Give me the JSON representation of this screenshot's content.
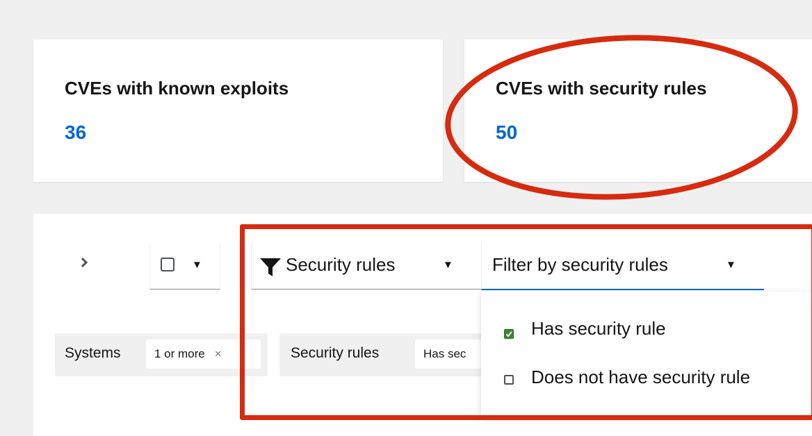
{
  "cards": [
    {
      "title": "CVEs with known exploits",
      "value": "36"
    },
    {
      "title": "CVEs with security rules",
      "value": "50"
    }
  ],
  "toolbar": {
    "expand_icon": "chevron-right-icon",
    "bulk_select_caret": "▼",
    "attribute_filter": {
      "label": "Security rules",
      "icon": "filter-icon",
      "caret": "▼"
    },
    "value_filter": {
      "placeholder": "Filter by security rules",
      "caret": "▼"
    }
  },
  "filter_chips": [
    {
      "category": "Systems",
      "chip": "1 or more",
      "close": "×"
    },
    {
      "category": "Security rules",
      "chip": "Has sec"
    }
  ],
  "menu": {
    "items": [
      {
        "label": "Has security rule",
        "checked": true
      },
      {
        "label": "Does not have security rule",
        "checked": false
      }
    ]
  },
  "colors": {
    "link_blue": "#0066cc",
    "annotation_red": "#d62b0e",
    "checkbox_green": "#3e8635"
  }
}
